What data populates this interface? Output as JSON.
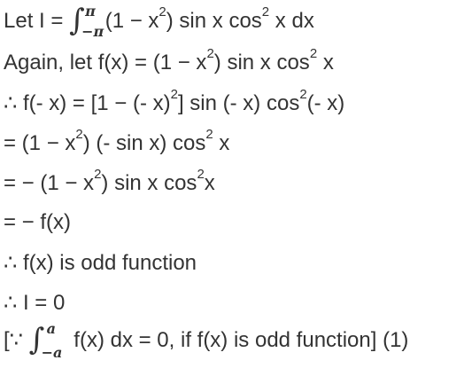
{
  "solution": {
    "line1": {
      "before": "Let I = ",
      "integral_upper": "π",
      "integral_lower": "−π",
      "a": " (1 − x",
      "sup1": "2",
      "b": ") sin x cos",
      "sup2": "2",
      "c": " x dx"
    },
    "line2": {
      "a": "Again, let f(x) = (1 − x",
      "sup1": "2",
      "b": ") sin x cos",
      "sup2": "2",
      "c": " x"
    },
    "line3": {
      "a": "∴ f(- x) = [1 − (- x)",
      "sup1": "2",
      "b": "] sin (- x) cos",
      "sup2": "2",
      "c": "(- x)"
    },
    "line4": {
      "a": "= (1 − x",
      "sup1": "2",
      "b": ") (- sin x) cos",
      "sup2": "2",
      "c": " x"
    },
    "line5": {
      "a": "= − (1 − x",
      "sup1": "2",
      "b": ") sin x cos",
      "sup2": "2",
      "c": "x"
    },
    "line6": "= − f(x)",
    "line7": "∴ f(x) is odd function",
    "line8": "∴ I = 0",
    "line9": {
      "before": "[∵ ",
      "integral_upper": "a",
      "integral_lower": "−a",
      "after": " f(x) dx = 0, if f(x) is odd function] (1)"
    }
  }
}
